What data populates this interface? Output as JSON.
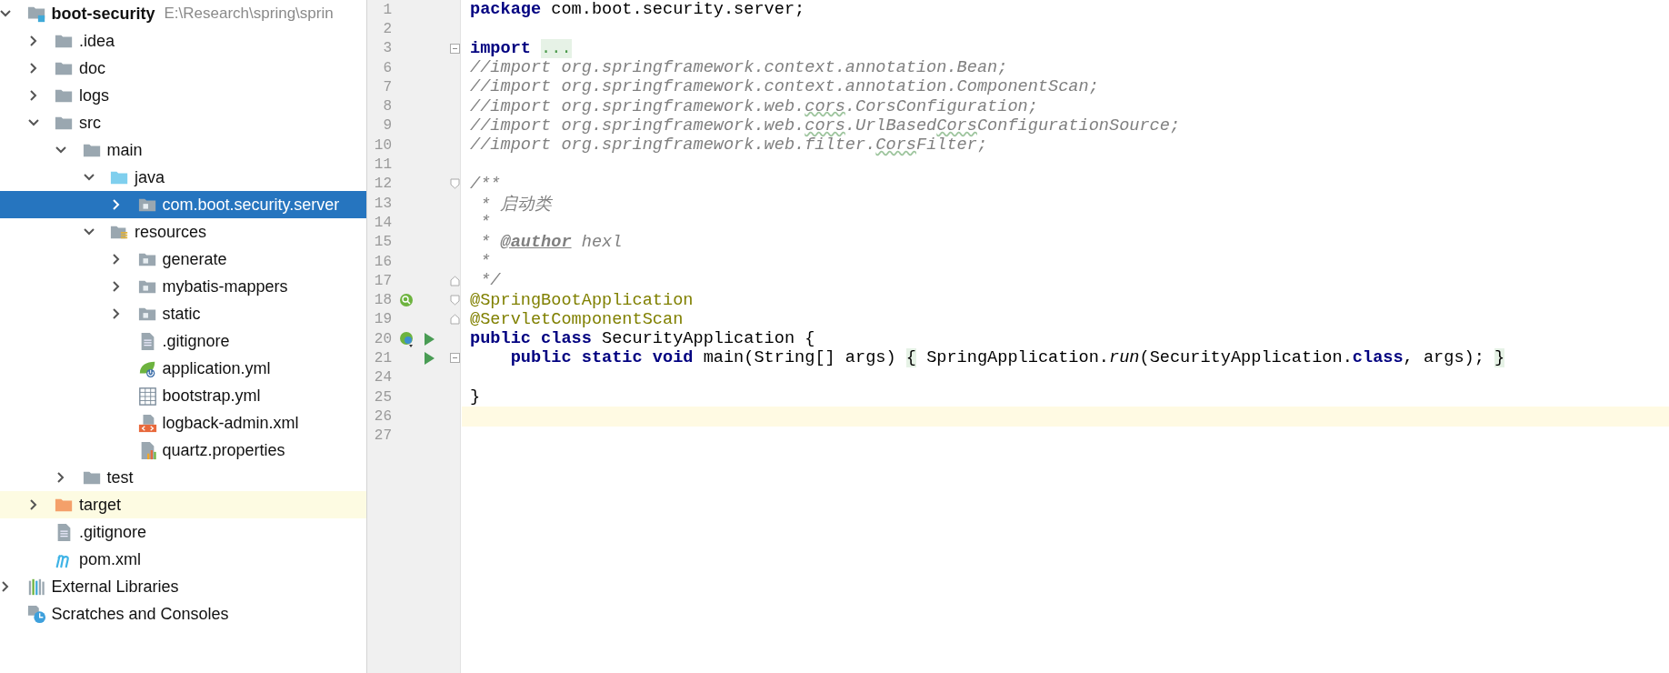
{
  "project_tree": {
    "items": [
      {
        "label": "boot-security",
        "path": "E:\\Research\\spring\\sprin",
        "kind": "project",
        "expanded": true,
        "selected": false,
        "highlighted": false,
        "children": [
          {
            "label": ".idea",
            "kind": "folder",
            "expanded": false,
            "selected": false,
            "highlighted": false
          },
          {
            "label": "doc",
            "kind": "folder",
            "expanded": false,
            "selected": false,
            "highlighted": false
          },
          {
            "label": "logs",
            "kind": "folder",
            "expanded": false,
            "selected": false,
            "highlighted": false
          },
          {
            "label": "src",
            "kind": "folder",
            "expanded": true,
            "selected": false,
            "highlighted": false,
            "children": [
              {
                "label": "main",
                "kind": "folder",
                "expanded": true,
                "selected": false,
                "highlighted": false,
                "children": [
                  {
                    "label": "java",
                    "kind": "source-folder",
                    "expanded": true,
                    "selected": false,
                    "highlighted": false,
                    "children": [
                      {
                        "label": "com.boot.security.server",
                        "kind": "package",
                        "expanded": false,
                        "selected": true,
                        "highlighted": false
                      }
                    ]
                  },
                  {
                    "label": "resources",
                    "kind": "resource-folder",
                    "expanded": true,
                    "selected": false,
                    "highlighted": false,
                    "children": [
                      {
                        "label": "generate",
                        "kind": "package",
                        "expanded": false,
                        "selected": false,
                        "highlighted": false
                      },
                      {
                        "label": "mybatis-mappers",
                        "kind": "package",
                        "expanded": false,
                        "selected": false,
                        "highlighted": false
                      },
                      {
                        "label": "static",
                        "kind": "package",
                        "expanded": false,
                        "selected": false,
                        "highlighted": false
                      },
                      {
                        "label": ".gitignore",
                        "kind": "text-file",
                        "selected": false,
                        "highlighted": false
                      },
                      {
                        "label": "application.yml",
                        "kind": "spring-file",
                        "selected": false,
                        "highlighted": false
                      },
                      {
                        "label": "bootstrap.yml",
                        "kind": "table-file",
                        "selected": false,
                        "highlighted": false
                      },
                      {
                        "label": "logback-admin.xml",
                        "kind": "xml-file",
                        "selected": false,
                        "highlighted": false
                      },
                      {
                        "label": "quartz.properties",
                        "kind": "properties-file",
                        "selected": false,
                        "highlighted": false
                      }
                    ]
                  }
                ]
              },
              {
                "label": "test",
                "kind": "folder",
                "expanded": false,
                "selected": false,
                "highlighted": false
              }
            ]
          },
          {
            "label": "target",
            "kind": "excluded-folder",
            "expanded": false,
            "selected": false,
            "highlighted": true
          },
          {
            "label": ".gitignore",
            "kind": "text-file",
            "selected": false,
            "highlighted": false
          },
          {
            "label": "pom.xml",
            "kind": "maven-file",
            "selected": false,
            "highlighted": false
          }
        ]
      },
      {
        "label": "External Libraries",
        "kind": "libraries",
        "expanded": false,
        "selected": false,
        "highlighted": false
      },
      {
        "label": "Scratches and Consoles",
        "kind": "scratches",
        "selected": false,
        "highlighted": false
      }
    ]
  },
  "editor": {
    "lines": [
      {
        "number": "1",
        "current": false,
        "spans": [
          {
            "kind": "keyword",
            "text": "package"
          },
          {
            "kind": "plain",
            "text": " com.boot.security.server;"
          }
        ]
      },
      {
        "number": "2",
        "current": false
      },
      {
        "number": "3",
        "current": false,
        "fold": {
          "kind": "folded"
        },
        "spans": [
          {
            "kind": "keyword",
            "text": "import "
          },
          {
            "kind": "folded",
            "text": "..."
          }
        ]
      },
      {
        "number": "6",
        "current": false,
        "spans": [
          {
            "kind": "comment",
            "text": "//import org.springframework.context.annotation.Bean;"
          }
        ]
      },
      {
        "number": "7",
        "current": false,
        "spans": [
          {
            "kind": "comment",
            "text": "//import org.springframework.context.annotation.ComponentScan;"
          }
        ]
      },
      {
        "number": "8",
        "current": false,
        "spans": [
          {
            "kind": "comment",
            "text": "//import org.springframework.web."
          },
          {
            "kind": "typo",
            "text": "cors"
          },
          {
            "kind": "comment",
            "text": ".CorsConfiguration;"
          }
        ]
      },
      {
        "number": "9",
        "current": false,
        "spans": [
          {
            "kind": "comment",
            "text": "//import org.springframework.web."
          },
          {
            "kind": "typo",
            "text": "cors"
          },
          {
            "kind": "comment",
            "text": ".UrlBased"
          },
          {
            "kind": "typo",
            "text": "Cors"
          },
          {
            "kind": "comment",
            "text": "ConfigurationSource;"
          }
        ]
      },
      {
        "number": "10",
        "current": false,
        "spans": [
          {
            "kind": "comment",
            "text": "//import org.springframework.web.filter."
          },
          {
            "kind": "typo",
            "text": "Cors"
          },
          {
            "kind": "comment",
            "text": "Filter;"
          }
        ]
      },
      {
        "number": "11",
        "current": false
      },
      {
        "number": "12",
        "current": false,
        "fold": {
          "kind": "start"
        },
        "spans": [
          {
            "kind": "comment",
            "text": "/**"
          }
        ]
      },
      {
        "number": "13",
        "current": false,
        "spans": [
          {
            "kind": "comment",
            "text": " * 启动类"
          }
        ]
      },
      {
        "number": "14",
        "current": false,
        "spans": [
          {
            "kind": "comment",
            "text": " *"
          }
        ]
      },
      {
        "number": "15",
        "current": false,
        "spans": [
          {
            "kind": "comment",
            "text": " * "
          },
          {
            "kind": "doc-tag",
            "text": "@author"
          },
          {
            "kind": "comment",
            "text": " hexl"
          }
        ]
      },
      {
        "number": "16",
        "current": false,
        "spans": [
          {
            "kind": "comment",
            "text": " *"
          }
        ]
      },
      {
        "number": "17",
        "current": false,
        "fold": {
          "kind": "end"
        },
        "spans": [
          {
            "kind": "comment",
            "text": " */"
          }
        ]
      },
      {
        "number": "18",
        "current": false,
        "fold": {
          "kind": "start"
        },
        "markers": [
          {
            "kind": "bean"
          }
        ],
        "spans": [
          {
            "kind": "annotation",
            "text": "@SpringBootApplication"
          }
        ]
      },
      {
        "number": "19",
        "current": false,
        "fold": {
          "kind": "end"
        },
        "spans": [
          {
            "kind": "annotation",
            "text": "@ServletComponentScan"
          }
        ]
      },
      {
        "number": "20",
        "current": false,
        "markers": [
          {
            "kind": "app"
          },
          {
            "kind": "run"
          }
        ],
        "spans": [
          {
            "kind": "keyword",
            "text": "public class"
          },
          {
            "kind": "plain",
            "text": " SecurityApplication {"
          }
        ]
      },
      {
        "number": "21",
        "current": false,
        "fold": {
          "kind": "folded"
        },
        "markers": [
          {
            "kind": "run"
          }
        ],
        "spans": [
          {
            "kind": "keyword",
            "text": "    public static void"
          },
          {
            "kind": "plain",
            "text": " main(String[] args) "
          },
          {
            "kind": "folded-brace",
            "text": "{"
          },
          {
            "kind": "plain",
            "text": " SpringApplication."
          },
          {
            "kind": "italic",
            "text": "run"
          },
          {
            "kind": "plain",
            "text": "(SecurityApplication."
          },
          {
            "kind": "keyword",
            "text": "class"
          },
          {
            "kind": "plain",
            "text": ", args); "
          },
          {
            "kind": "folded-brace",
            "text": "}"
          }
        ]
      },
      {
        "number": "24",
        "current": false
      },
      {
        "number": "25",
        "current": false,
        "spans": [
          {
            "kind": "plain",
            "text": "}"
          }
        ]
      },
      {
        "number": "26",
        "current": true
      },
      {
        "number": "27",
        "current": false
      }
    ]
  }
}
